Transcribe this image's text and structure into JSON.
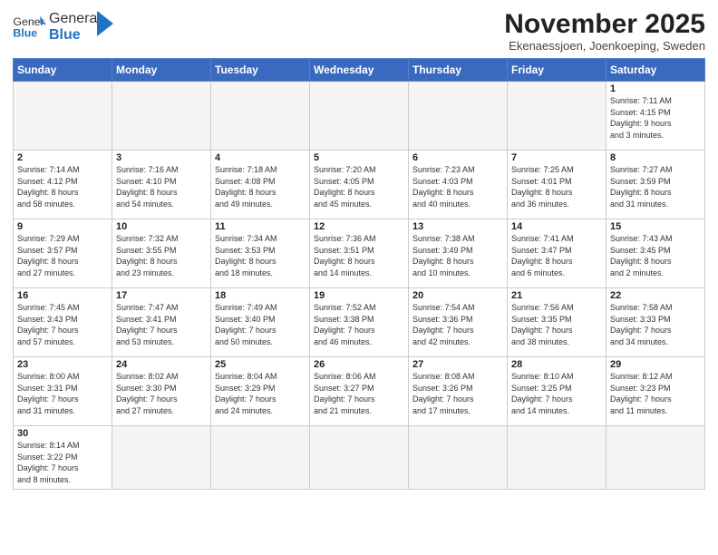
{
  "logo": {
    "text_general": "General",
    "text_blue": "Blue"
  },
  "header": {
    "month": "November 2025",
    "location": "Ekenaessjoen, Joenkoeping, Sweden"
  },
  "weekdays": [
    "Sunday",
    "Monday",
    "Tuesday",
    "Wednesday",
    "Thursday",
    "Friday",
    "Saturday"
  ],
  "weeks": [
    [
      {
        "day": "",
        "info": ""
      },
      {
        "day": "",
        "info": ""
      },
      {
        "day": "",
        "info": ""
      },
      {
        "day": "",
        "info": ""
      },
      {
        "day": "",
        "info": ""
      },
      {
        "day": "",
        "info": ""
      },
      {
        "day": "1",
        "info": "Sunrise: 7:11 AM\nSunset: 4:15 PM\nDaylight: 9 hours\nand 3 minutes."
      }
    ],
    [
      {
        "day": "2",
        "info": "Sunrise: 7:14 AM\nSunset: 4:12 PM\nDaylight: 8 hours\nand 58 minutes."
      },
      {
        "day": "3",
        "info": "Sunrise: 7:16 AM\nSunset: 4:10 PM\nDaylight: 8 hours\nand 54 minutes."
      },
      {
        "day": "4",
        "info": "Sunrise: 7:18 AM\nSunset: 4:08 PM\nDaylight: 8 hours\nand 49 minutes."
      },
      {
        "day": "5",
        "info": "Sunrise: 7:20 AM\nSunset: 4:05 PM\nDaylight: 8 hours\nand 45 minutes."
      },
      {
        "day": "6",
        "info": "Sunrise: 7:23 AM\nSunset: 4:03 PM\nDaylight: 8 hours\nand 40 minutes."
      },
      {
        "day": "7",
        "info": "Sunrise: 7:25 AM\nSunset: 4:01 PM\nDaylight: 8 hours\nand 36 minutes."
      },
      {
        "day": "8",
        "info": "Sunrise: 7:27 AM\nSunset: 3:59 PM\nDaylight: 8 hours\nand 31 minutes."
      }
    ],
    [
      {
        "day": "9",
        "info": "Sunrise: 7:29 AM\nSunset: 3:57 PM\nDaylight: 8 hours\nand 27 minutes."
      },
      {
        "day": "10",
        "info": "Sunrise: 7:32 AM\nSunset: 3:55 PM\nDaylight: 8 hours\nand 23 minutes."
      },
      {
        "day": "11",
        "info": "Sunrise: 7:34 AM\nSunset: 3:53 PM\nDaylight: 8 hours\nand 18 minutes."
      },
      {
        "day": "12",
        "info": "Sunrise: 7:36 AM\nSunset: 3:51 PM\nDaylight: 8 hours\nand 14 minutes."
      },
      {
        "day": "13",
        "info": "Sunrise: 7:38 AM\nSunset: 3:49 PM\nDaylight: 8 hours\nand 10 minutes."
      },
      {
        "day": "14",
        "info": "Sunrise: 7:41 AM\nSunset: 3:47 PM\nDaylight: 8 hours\nand 6 minutes."
      },
      {
        "day": "15",
        "info": "Sunrise: 7:43 AM\nSunset: 3:45 PM\nDaylight: 8 hours\nand 2 minutes."
      }
    ],
    [
      {
        "day": "16",
        "info": "Sunrise: 7:45 AM\nSunset: 3:43 PM\nDaylight: 7 hours\nand 57 minutes."
      },
      {
        "day": "17",
        "info": "Sunrise: 7:47 AM\nSunset: 3:41 PM\nDaylight: 7 hours\nand 53 minutes."
      },
      {
        "day": "18",
        "info": "Sunrise: 7:49 AM\nSunset: 3:40 PM\nDaylight: 7 hours\nand 50 minutes."
      },
      {
        "day": "19",
        "info": "Sunrise: 7:52 AM\nSunset: 3:38 PM\nDaylight: 7 hours\nand 46 minutes."
      },
      {
        "day": "20",
        "info": "Sunrise: 7:54 AM\nSunset: 3:36 PM\nDaylight: 7 hours\nand 42 minutes."
      },
      {
        "day": "21",
        "info": "Sunrise: 7:56 AM\nSunset: 3:35 PM\nDaylight: 7 hours\nand 38 minutes."
      },
      {
        "day": "22",
        "info": "Sunrise: 7:58 AM\nSunset: 3:33 PM\nDaylight: 7 hours\nand 34 minutes."
      }
    ],
    [
      {
        "day": "23",
        "info": "Sunrise: 8:00 AM\nSunset: 3:31 PM\nDaylight: 7 hours\nand 31 minutes."
      },
      {
        "day": "24",
        "info": "Sunrise: 8:02 AM\nSunset: 3:30 PM\nDaylight: 7 hours\nand 27 minutes."
      },
      {
        "day": "25",
        "info": "Sunrise: 8:04 AM\nSunset: 3:29 PM\nDaylight: 7 hours\nand 24 minutes."
      },
      {
        "day": "26",
        "info": "Sunrise: 8:06 AM\nSunset: 3:27 PM\nDaylight: 7 hours\nand 21 minutes."
      },
      {
        "day": "27",
        "info": "Sunrise: 8:08 AM\nSunset: 3:26 PM\nDaylight: 7 hours\nand 17 minutes."
      },
      {
        "day": "28",
        "info": "Sunrise: 8:10 AM\nSunset: 3:25 PM\nDaylight: 7 hours\nand 14 minutes."
      },
      {
        "day": "29",
        "info": "Sunrise: 8:12 AM\nSunset: 3:23 PM\nDaylight: 7 hours\nand 11 minutes."
      }
    ],
    [
      {
        "day": "30",
        "info": "Sunrise: 8:14 AM\nSunset: 3:22 PM\nDaylight: 7 hours\nand 8 minutes."
      },
      {
        "day": "",
        "info": ""
      },
      {
        "day": "",
        "info": ""
      },
      {
        "day": "",
        "info": ""
      },
      {
        "day": "",
        "info": ""
      },
      {
        "day": "",
        "info": ""
      },
      {
        "day": "",
        "info": ""
      }
    ]
  ]
}
